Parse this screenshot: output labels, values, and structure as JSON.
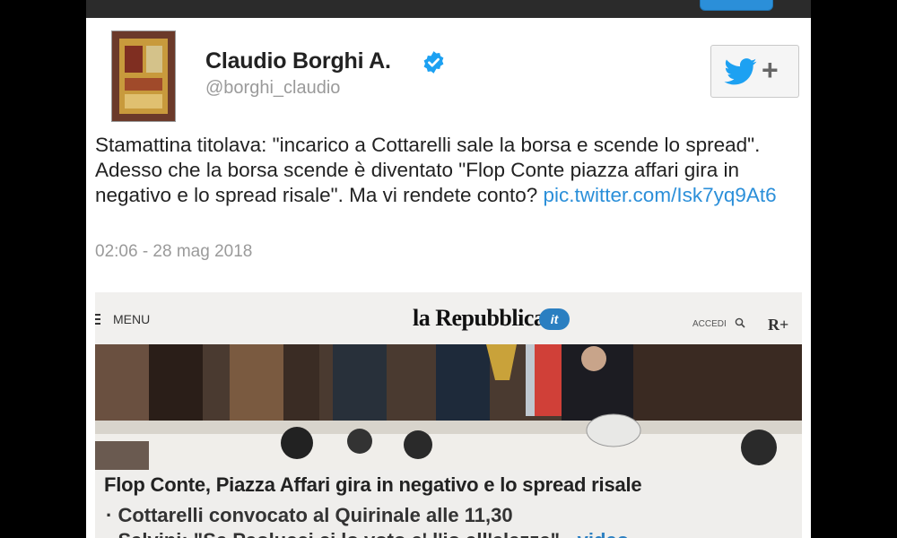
{
  "tweet": {
    "author_name": "Claudio Borghi A.",
    "handle": "@borghi_claudio",
    "text": "Stamattina titolava: \"incarico a Cottarelli sale la borsa e scende lo spread\". Adesso che la borsa scende è diventato \"Flop Conte piazza affari gira in negativo e lo spread risale\". Ma vi rendete conto? ",
    "link": "pic.twitter.com/Isk7yq9At6",
    "timestamp": "02:06 - 28 mag 2018"
  },
  "follow_button": {
    "icon": "twitter-bird-icon",
    "plus": "+"
  },
  "embedded_photo": {
    "menu_label": "MENU",
    "site_logo": "la Repubblica",
    "site_logo_suffix": "it",
    "accedi_label": "ACCEDI",
    "rplus_label": "R+",
    "headline": "Flop Conte, Piazza Affari gira in negativo e lo spread risale",
    "bullet_1": "· Cottarelli convocato al Quirinale alle 11,30",
    "bullet_2_text": "· Salvini: \"Se Paolucci ci lo voto e' l'io all'elezze\" - ",
    "bullet_2_link": "video"
  },
  "colors": {
    "accent": "#2b8fd9",
    "verified": "#1da1f2"
  }
}
